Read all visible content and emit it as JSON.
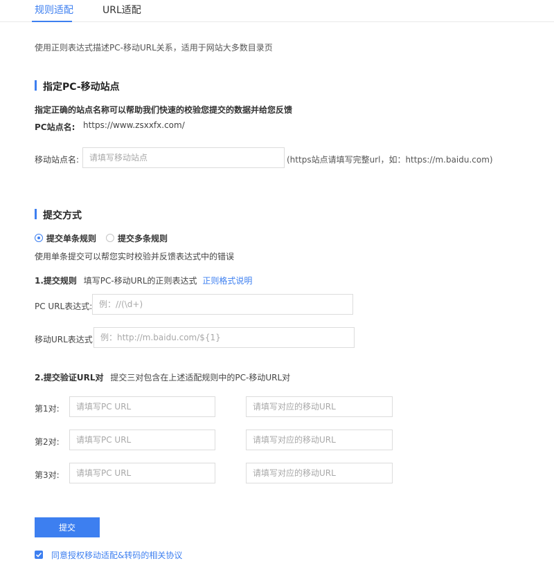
{
  "tabs": {
    "rule": "规则适配",
    "url": "URL适配"
  },
  "intro": "使用正则表达式描述PC-移动URL关系，适用于网站大多数目录页",
  "site_section": {
    "title": "指定PC-移动站点",
    "hint": "指定正确的站点名称可以帮助我们快速的校验您提交的数据并给您反馈",
    "pc_label": "PC站点名:",
    "pc_value": "https://www.zsxxfx.com/",
    "mobile_label": "移动站点名:",
    "mobile_placeholder": "请填写移动站点",
    "mobile_note": "(https站点请填写完整url，如：https://m.baidu.com)"
  },
  "submit_section": {
    "title": "提交方式",
    "option_single": "提交单条规则",
    "option_multi": "提交多条规则",
    "single_hint": "使用单条提交可以帮您实时校验并反馈表达式中的错误",
    "rule_step": {
      "label": "1.提交规则",
      "desc": "填写PC-移动URL的正则表达式",
      "link": "正则格式说明"
    },
    "pc_expr_label": "PC  URL表达式:",
    "pc_expr_placeholder": "例：//(\\d+)",
    "mobile_expr_label": "移动URL表达式:",
    "mobile_expr_placeholder": "例：http://m.baidu.com/${1}",
    "verify_step": {
      "label": "2.提交验证URL对",
      "desc": "提交三对包含在上述适配规则中的PC-移动URL对"
    },
    "pairs": [
      {
        "label": "第1对:",
        "pc_placeholder": "请填写PC URL",
        "mobile_placeholder": "请填写对应的移动URL"
      },
      {
        "label": "第2对:",
        "pc_placeholder": "请填写PC URL",
        "mobile_placeholder": "请填写对应的移动URL"
      },
      {
        "label": "第3对:",
        "pc_placeholder": "请填写PC URL",
        "mobile_placeholder": "请填写对应的移动URL"
      }
    ]
  },
  "submit_button": "提交",
  "agreement": "同意授权移动适配&转码的相关协议",
  "colors": {
    "accent": "#3d7ff0",
    "border": "#dcdcdc",
    "placeholder": "#a8a8a8"
  }
}
